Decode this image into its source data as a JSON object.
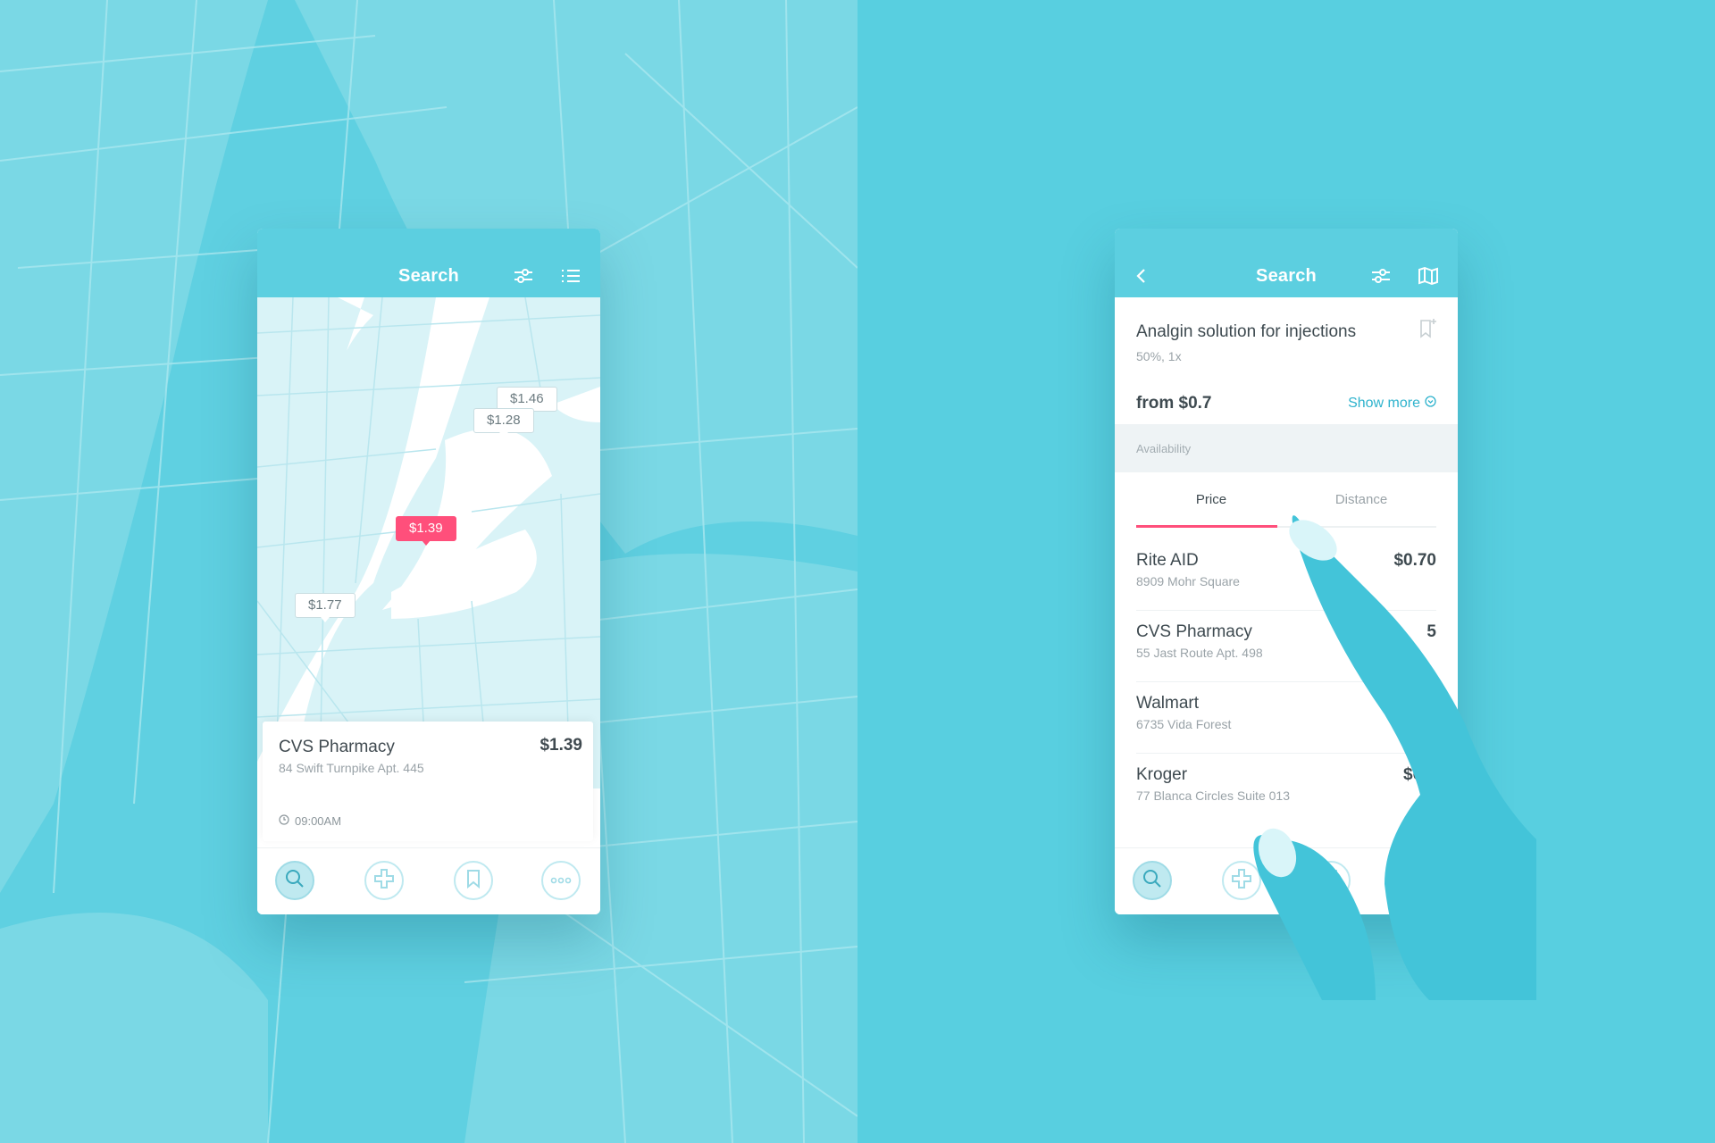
{
  "colors": {
    "accent": "#5ccfe0",
    "highlight": "#ff4f7b",
    "background": "#58cfe0"
  },
  "map_screen": {
    "header": {
      "title": "Search",
      "icons": [
        "filter-icon",
        "list-icon"
      ]
    },
    "price_tags": [
      "$1.46",
      "$1.28",
      "$1.39",
      "$1.77"
    ],
    "selected_tag": "$1.39",
    "card": {
      "name": "CVS Pharmacy",
      "price": "$1.39",
      "address": "84 Swift Turnpike Apt. 445",
      "time": "09:00AM"
    },
    "tabbar": {
      "icons": [
        "search-icon",
        "plus-icon",
        "bookmark-icon",
        "more-icon"
      ],
      "active": "search-icon"
    }
  },
  "detail_screen": {
    "header": {
      "title": "Search",
      "icons": [
        "back-icon",
        "filter-icon",
        "map-icon"
      ]
    },
    "drug": {
      "name": "Analgin solution for injections",
      "details": "50%, 1x",
      "from_price": "from $0.7",
      "show_more": "Show more"
    },
    "section_label": "Availability",
    "tabs": [
      {
        "label": "Price",
        "active": true
      },
      {
        "label": "Distance",
        "active": false
      }
    ],
    "pharmacies": [
      {
        "name": "Rite AID",
        "address": "8909 Mohr Square",
        "price": "$0.70"
      },
      {
        "name": "CVS Pharmacy",
        "address": "55 Jast Route Apt. 498",
        "price": "5"
      },
      {
        "name": "Walmart",
        "address": "6735 Vida Forest",
        "price": ""
      },
      {
        "name": "Kroger",
        "address": "77 Blanca Circles Suite 013",
        "price": "$0.8"
      }
    ],
    "tabbar": {
      "icons": [
        "search-icon",
        "plus-icon",
        "bookmark-icon",
        "more-icon"
      ],
      "active": "search-icon"
    }
  }
}
